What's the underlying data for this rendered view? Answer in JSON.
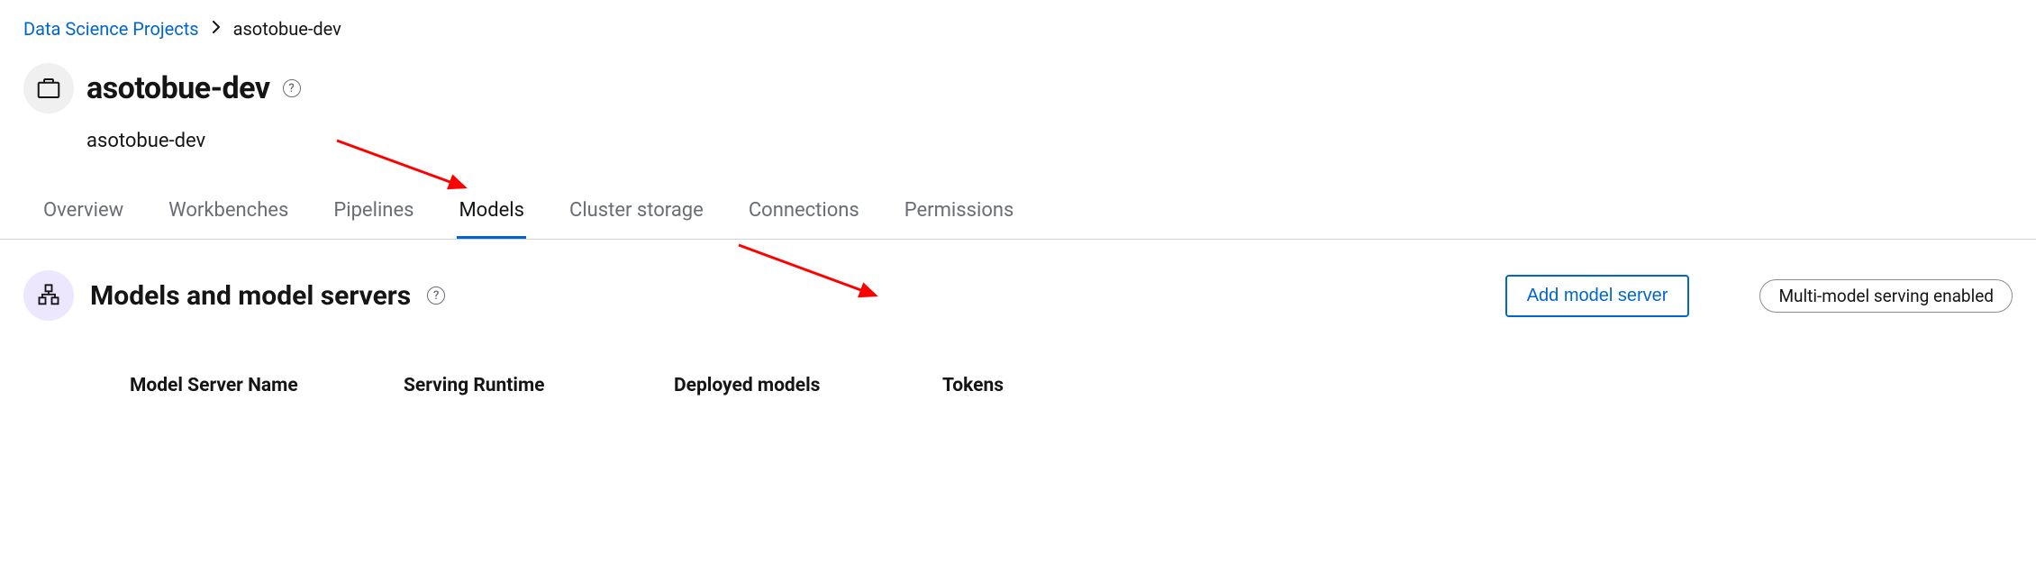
{
  "breadcrumb": {
    "parent": "Data Science Projects",
    "current": "asotobue-dev"
  },
  "title": "asotobue-dev",
  "subtitle": "asotobue-dev",
  "tabs": [
    {
      "label": "Overview",
      "active": false
    },
    {
      "label": "Workbenches",
      "active": false
    },
    {
      "label": "Pipelines",
      "active": false
    },
    {
      "label": "Models",
      "active": true
    },
    {
      "label": "Cluster storage",
      "active": false
    },
    {
      "label": "Connections",
      "active": false
    },
    {
      "label": "Permissions",
      "active": false
    }
  ],
  "section": {
    "title": "Models and model servers",
    "add_button": "Add model server",
    "badge": "Multi-model serving enabled"
  },
  "table": {
    "columns": [
      "Model Server Name",
      "Serving Runtime",
      "Deployed models",
      "Tokens"
    ]
  }
}
